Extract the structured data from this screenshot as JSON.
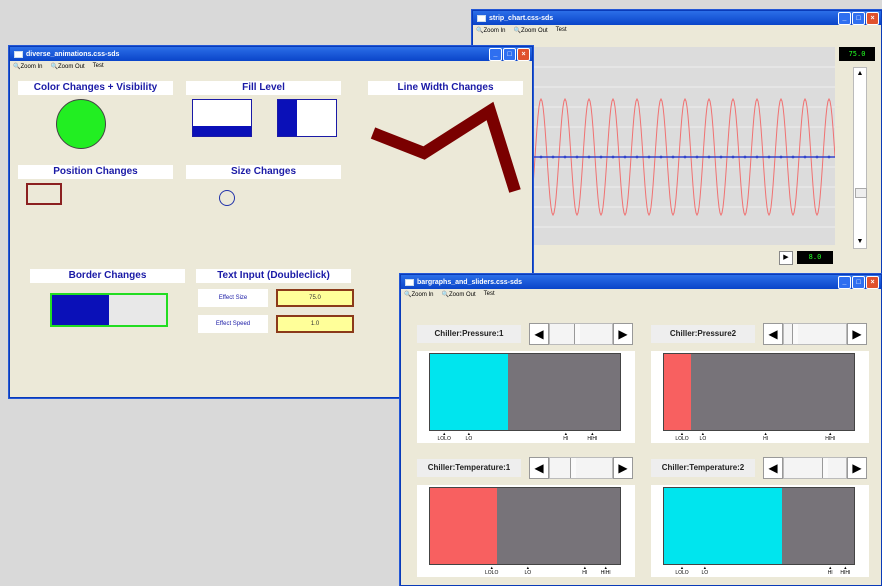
{
  "strip": {
    "title": "strip_chart.css-sds",
    "menu": [
      "Zoom In",
      "Zoom Out",
      "Test"
    ],
    "readout_top": "75.0",
    "readout_bottom": "8.0"
  },
  "diverse": {
    "title": "diverse_animations.css-sds",
    "menu": [
      "Zoom In",
      "Zoom Out",
      "Test"
    ],
    "sections": {
      "color": "Color Changes + Visibility",
      "fill": "Fill Level",
      "linewidth": "Line Width Changes",
      "position": "Position Changes",
      "size": "Size Changes",
      "border": "Border Changes",
      "textinput": "Text Input (Doubleclick)"
    },
    "fields": [
      {
        "label": "Effect Size",
        "value": "75.0"
      },
      {
        "label": "Effect Speed",
        "value": "1.0"
      }
    ],
    "colors": {
      "circle": "#22ee22",
      "fill": "#0a10b8",
      "line": "#7a0000",
      "border_green": "#22dd22"
    },
    "levels": {
      "fill_horizontal": 0.28,
      "fill_vertical": 0.32,
      "border_bar": 0.5
    }
  },
  "bargraphs": {
    "title": "bargraphs_and_sliders.css-sds",
    "menu": [
      "Zoom In",
      "Zoom Out",
      "Test"
    ],
    "panels": [
      {
        "title": "Chiller:Pressure:1",
        "level": 0.41,
        "color": "#00e5ee",
        "ticks": [
          "LOLO",
          "LO",
          "HI",
          "HIHI"
        ]
      },
      {
        "title": "Chiller:Pressure2",
        "level": 0.14,
        "color": "#f86060",
        "ticks": [
          "LOLO",
          "LO",
          "HI",
          "HIHI"
        ]
      },
      {
        "title": "Chiller:Temperature:1",
        "level": 0.35,
        "color": "#f86060",
        "ticks": [
          "LOLO",
          "LO",
          "HI",
          "HIHI"
        ]
      },
      {
        "title": "Chiller:Temperature:2",
        "level": 0.62,
        "color": "#00e5ee",
        "ticks": [
          "LOLO",
          "LO",
          "HI",
          "HIHI"
        ]
      }
    ]
  }
}
